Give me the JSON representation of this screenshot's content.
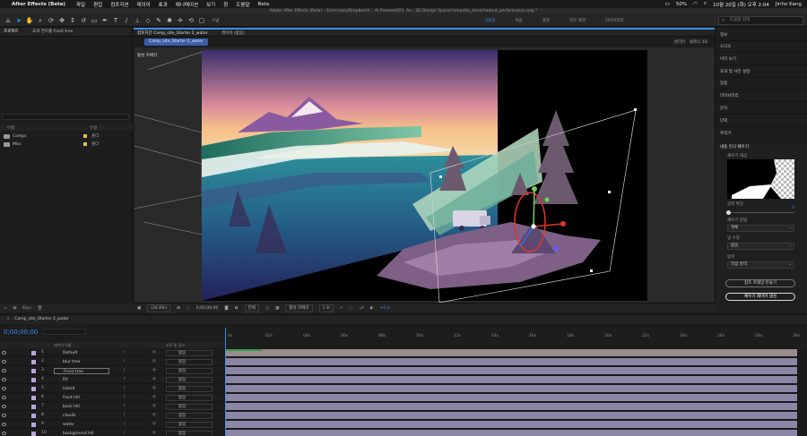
{
  "menubar": {
    "app_name": "After Effects (Beta)",
    "items": [
      "파일",
      "편집",
      "컴포지션",
      "레이어",
      "효과",
      "애니메이션",
      "보기",
      "창",
      "도움말",
      "Beta"
    ],
    "status": {
      "battery": "50%",
      "datetime": "10월 20일 (화) 오후 2:04",
      "user": "Jinho Kang"
    }
  },
  "title_bar": "Adobe After Effects (Beta) - /Users/azn/Dropbox/A... AI Powered/03. Ae - 3D Design Space/campsite_stretchedout_performance.aep *",
  "toolbar": {
    "snap_label": "스냅",
    "workspaces": [
      "기본값",
      "학습",
      "표준",
      "작은 화면",
      "라이브러리"
    ],
    "search_placeholder": "도움말 검색"
  },
  "project_panel": {
    "tabs": [
      "프로젝트",
      "효과 컨트롤 Front tree"
    ],
    "columns": [
      "이름",
      "유형"
    ],
    "rows": [
      {
        "name": "Comps",
        "type": "폴더"
      },
      {
        "name": "Misc",
        "type": "폴더"
      }
    ],
    "bpc": "8bpc"
  },
  "comp_panel": {
    "tab": "컴포지션 Camp_site_Starter 2_water",
    "layer_tab": "레이어 (없음)",
    "subtab": "Camp_site_Starter 2_water",
    "renderer_label": "렌더러",
    "renderer_value": "클래식 3D",
    "camera_label": "활성 카메라",
    "controls": {
      "zoom": "(34.8%)",
      "timecode": "0;00;00;00",
      "resolution": "전체",
      "camera": "활성 카메라",
      "views": "1 보",
      "exposure": "+0.0"
    }
  },
  "right_panel": {
    "items": [
      "정보",
      "오디오",
      "미리 보기",
      "효과 및 사전 설정",
      "맞춤",
      "라이브러리",
      "문자",
      "단락",
      "추적기"
    ],
    "fill": {
      "title": "내용 인식 채우기",
      "fill_target_label": "채우기 대상",
      "alpha_label": "알파 확장",
      "alpha_value": "0",
      "method_label": "채우기 방법",
      "method_value": "객체",
      "lighting_label": "빛 수정",
      "lighting_value": "없음",
      "range_label": "범위",
      "range_value": "작업 영역",
      "btn_reference": "참조 프레임 만들기",
      "btn_generate": "채우기 레이어 생성"
    }
  },
  "timeline": {
    "tab": "Camp_site_Starter 2_water",
    "timecode": "0;00;00;00",
    "col_source": "레이어 이름",
    "col_parent": "부모 및 링크",
    "ruler": [
      "0s",
      "02s",
      "04s",
      "06s",
      "08s",
      "10s",
      "12s",
      "14s",
      "16s",
      "18s",
      "20s",
      "22s",
      "24s",
      "26s",
      "28s",
      "30s"
    ],
    "layers": [
      {
        "num": "1",
        "name": "Default",
        "parent": "없음"
      },
      {
        "num": "2",
        "name": "blur tree",
        "parent": "없음"
      },
      {
        "num": "3",
        "name": "Front tree",
        "parent": "없음"
      },
      {
        "num": "4",
        "name": "RV",
        "parent": "없음"
      },
      {
        "num": "5",
        "name": "island",
        "parent": "없음"
      },
      {
        "num": "6",
        "name": "front hill",
        "parent": "없음"
      },
      {
        "num": "7",
        "name": "back hill",
        "parent": "없음"
      },
      {
        "num": "8",
        "name": "clouds",
        "parent": "없음"
      },
      {
        "num": "9",
        "name": "water",
        "parent": "없음"
      },
      {
        "num": "10",
        "name": "background hill",
        "parent": "없음"
      }
    ]
  },
  "colors": {
    "accent": "#3b8ded",
    "layer_bar": "#8a86a6",
    "label_yellow": "#e7c23a"
  }
}
